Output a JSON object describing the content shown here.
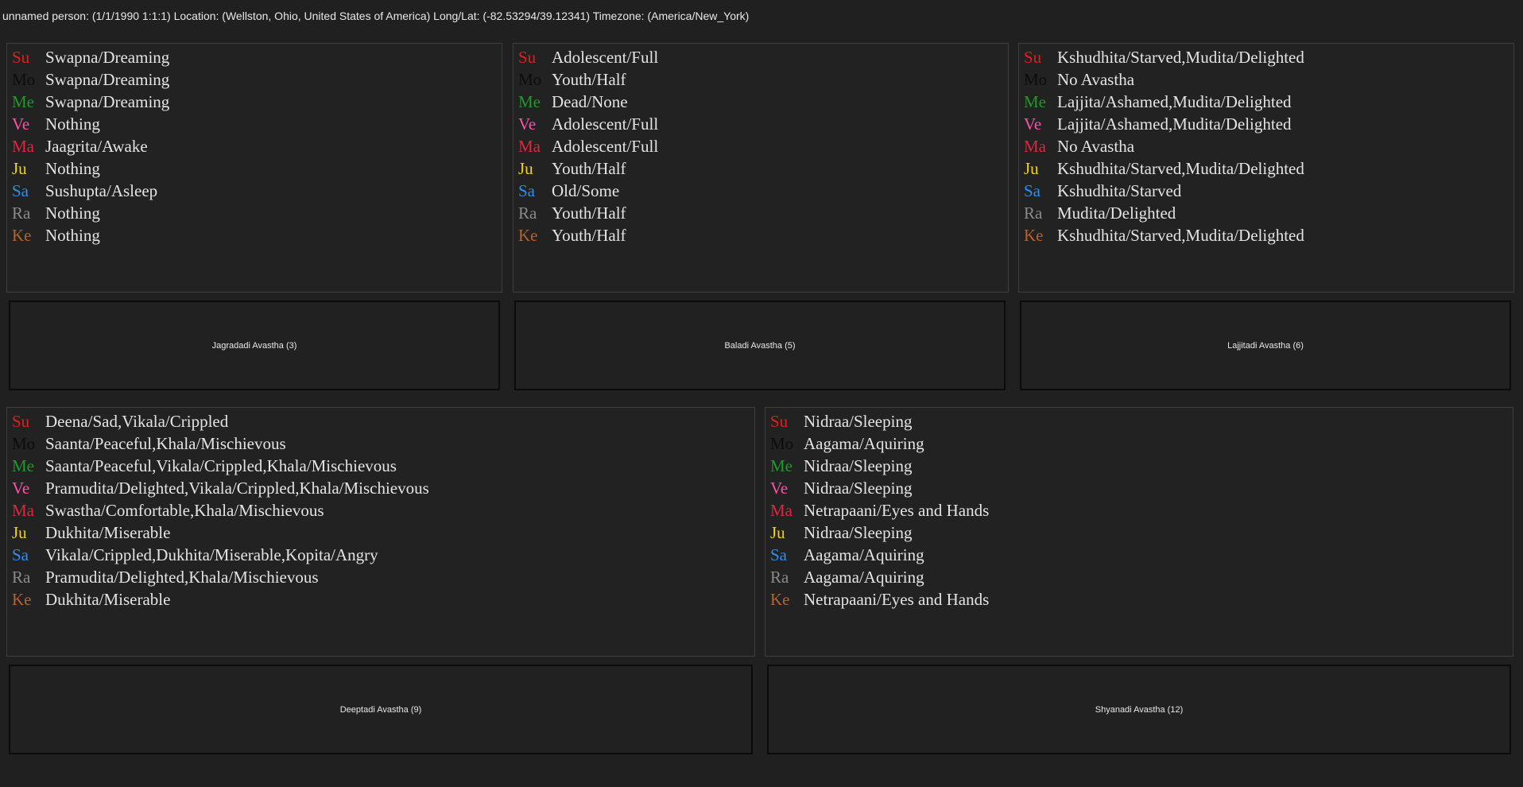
{
  "header": "unnamed person: (1/1/1990 1:1:1) Location: (Wellston, Ohio, United States of America) Long/Lat: (-82.53294/39.12341) Timezone: (America/New_York)",
  "planet_colors": {
    "Su": "#e01f1f",
    "Mo": "#0c0c0c",
    "Me": "#1e9a2a",
    "Ve": "#ff4fa8",
    "Ma": "#e0263e",
    "Ju": "#f2d21b",
    "Sa": "#2e8ef0",
    "Ra": "#8a8a8a",
    "Ke": "#b5622b"
  },
  "panels": [
    {
      "button": "Jagradadi Avastha (3)",
      "rows": [
        {
          "p": "Su",
          "v": "Swapna/Dreaming"
        },
        {
          "p": "Mo",
          "v": "Swapna/Dreaming"
        },
        {
          "p": "Me",
          "v": "Swapna/Dreaming"
        },
        {
          "p": "Ve",
          "v": "Nothing"
        },
        {
          "p": "Ma",
          "v": "Jaagrita/Awake"
        },
        {
          "p": "Ju",
          "v": "Nothing"
        },
        {
          "p": "Sa",
          "v": "Sushupta/Asleep"
        },
        {
          "p": "Ra",
          "v": "Nothing"
        },
        {
          "p": "Ke",
          "v": "Nothing"
        }
      ]
    },
    {
      "button": "Baladi Avastha (5)",
      "rows": [
        {
          "p": "Su",
          "v": "Adolescent/Full"
        },
        {
          "p": "Mo",
          "v": "Youth/Half"
        },
        {
          "p": "Me",
          "v": "Dead/None"
        },
        {
          "p": "Ve",
          "v": "Adolescent/Full"
        },
        {
          "p": "Ma",
          "v": "Adolescent/Full"
        },
        {
          "p": "Ju",
          "v": "Youth/Half"
        },
        {
          "p": "Sa",
          "v": "Old/Some"
        },
        {
          "p": "Ra",
          "v": "Youth/Half"
        },
        {
          "p": "Ke",
          "v": "Youth/Half"
        }
      ]
    },
    {
      "button": "Lajjitadi Avastha (6)",
      "rows": [
        {
          "p": "Su",
          "v": "Kshudhita/Starved,Mudita/Delighted"
        },
        {
          "p": "Mo",
          "v": "No Avastha"
        },
        {
          "p": "Me",
          "v": "Lajjita/Ashamed,Mudita/Delighted"
        },
        {
          "p": "Ve",
          "v": "Lajjita/Ashamed,Mudita/Delighted"
        },
        {
          "p": "Ma",
          "v": "No Avastha"
        },
        {
          "p": "Ju",
          "v": "Kshudhita/Starved,Mudita/Delighted"
        },
        {
          "p": "Sa",
          "v": "Kshudhita/Starved"
        },
        {
          "p": "Ra",
          "v": "Mudita/Delighted"
        },
        {
          "p": "Ke",
          "v": "Kshudhita/Starved,Mudita/Delighted"
        }
      ]
    },
    {
      "button": "Deeptadi Avastha (9)",
      "rows": [
        {
          "p": "Su",
          "v": "Deena/Sad,Vikala/Crippled"
        },
        {
          "p": "Mo",
          "v": "Saanta/Peaceful,Khala/Mischievous"
        },
        {
          "p": "Me",
          "v": "Saanta/Peaceful,Vikala/Crippled,Khala/Mischievous"
        },
        {
          "p": "Ve",
          "v": "Pramudita/Delighted,Vikala/Crippled,Khala/Mischievous"
        },
        {
          "p": "Ma",
          "v": "Swastha/Comfortable,Khala/Mischievous"
        },
        {
          "p": "Ju",
          "v": "Dukhita/Miserable"
        },
        {
          "p": "Sa",
          "v": "Vikala/Crippled,Dukhita/Miserable,Kopita/Angry"
        },
        {
          "p": "Ra",
          "v": "Pramudita/Delighted,Khala/Mischievous"
        },
        {
          "p": "Ke",
          "v": "Dukhita/Miserable"
        }
      ]
    },
    {
      "button": "Shyanadi Avastha (12)",
      "rows": [
        {
          "p": "Su",
          "v": "Nidraa/Sleeping"
        },
        {
          "p": "Mo",
          "v": "Aagama/Aquiring"
        },
        {
          "p": "Me",
          "v": "Nidraa/Sleeping"
        },
        {
          "p": "Ve",
          "v": "Nidraa/Sleeping"
        },
        {
          "p": "Ma",
          "v": "Netrapaani/Eyes and Hands"
        },
        {
          "p": "Ju",
          "v": "Nidraa/Sleeping"
        },
        {
          "p": "Sa",
          "v": "Aagama/Aquiring"
        },
        {
          "p": "Ra",
          "v": "Aagama/Aquiring"
        },
        {
          "p": "Ke",
          "v": "Netrapaani/Eyes and Hands"
        }
      ]
    }
  ]
}
